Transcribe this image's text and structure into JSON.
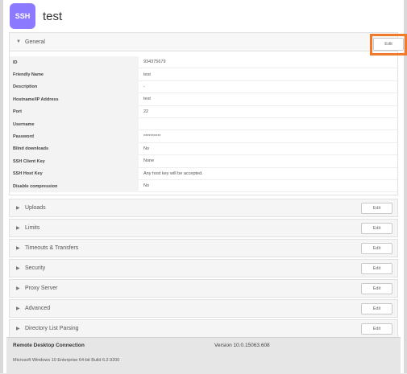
{
  "header": {
    "badge": "SSH",
    "title": "test"
  },
  "general": {
    "label": "General",
    "edit_label": "Edit",
    "rows": [
      {
        "key": "ID",
        "value": "934375679"
      },
      {
        "key": "Friendly Name",
        "value": "test"
      },
      {
        "key": "Description",
        "value": "-"
      },
      {
        "key": "Hostname/IP Address",
        "value": "test"
      },
      {
        "key": "Port",
        "value": "22"
      },
      {
        "key": "Username",
        "value": ""
      },
      {
        "key": "Password",
        "value": "**********"
      },
      {
        "key": "Blind downloads",
        "value": "No"
      },
      {
        "key": "SSH Client Key",
        "value": "None"
      },
      {
        "key": "SSH Host Key",
        "value": "Any host key will be accepted."
      },
      {
        "key": "Disable compression",
        "value": "No"
      }
    ]
  },
  "sections": [
    {
      "label": "Uploads",
      "edit_label": "Edit"
    },
    {
      "label": "Limits",
      "edit_label": "Edit"
    },
    {
      "label": "Timeouts & Transfers",
      "edit_label": "Edit"
    },
    {
      "label": "Security",
      "edit_label": "Edit"
    },
    {
      "label": "Proxy Server",
      "edit_label": "Edit"
    },
    {
      "label": "Advanced",
      "edit_label": "Edit"
    },
    {
      "label": "Directory List Parsing",
      "edit_label": "Edit"
    }
  ],
  "footer": {
    "title": "Remote Desktop Connection",
    "version": "Version 10.0.15063.608",
    "os": "Microsoft Windows 10 Enterprise 64-bit Build 6.2.9200"
  },
  "colors": {
    "badge": "#8b79ff",
    "highlight": "#f07a2a"
  },
  "icons": {
    "expanded": "caret-down-icon",
    "collapsed": "caret-right-icon"
  }
}
